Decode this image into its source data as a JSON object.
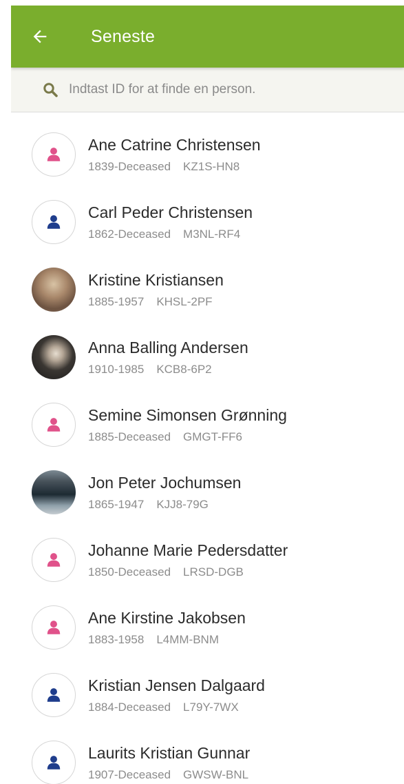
{
  "header": {
    "title": "Seneste",
    "back_icon": "arrow-left-icon",
    "color": "#7aae2d"
  },
  "search": {
    "placeholder": "Indtast ID for at finde en person.",
    "icon": "search-icon"
  },
  "colors": {
    "female": "#e0528a",
    "male": "#1f3d8c"
  },
  "people": [
    {
      "name": "Ane Catrine Christensen",
      "years": "1839-Deceased",
      "id": "KZ1S-HN8",
      "avatar": "female-icon"
    },
    {
      "name": "Carl Peder Christensen",
      "years": "1862-Deceased",
      "id": "M3NL-RF4",
      "avatar": "male-icon"
    },
    {
      "name": "Kristine Kristiansen",
      "years": "1885-1957",
      "id": "KHSL-2PF",
      "avatar": "photo"
    },
    {
      "name": "Anna Balling Andersen",
      "years": "1910-1985",
      "id": "KCB8-6P2",
      "avatar": "photo"
    },
    {
      "name": "Semine Simonsen Grønning",
      "years": "1885-Deceased",
      "id": "GMGT-FF6",
      "avatar": "female-icon"
    },
    {
      "name": "Jon Peter Jochumsen",
      "years": "1865-1947",
      "id": "KJJ8-79G",
      "avatar": "photo"
    },
    {
      "name": "Johanne Marie Pedersdatter",
      "years": "1850-Deceased",
      "id": "LRSD-DGB",
      "avatar": "female-icon"
    },
    {
      "name": "Ane Kirstine Jakobsen",
      "years": "1883-1958",
      "id": "L4MM-BNM",
      "avatar": "female-icon"
    },
    {
      "name": "Kristian Jensen Dalgaard",
      "years": "1884-Deceased",
      "id": "L79Y-7WX",
      "avatar": "male-icon"
    },
    {
      "name": "Laurits Kristian Gunnar",
      "years": "1907-Deceased",
      "id": "GWSW-BNL",
      "avatar": "male-icon"
    }
  ]
}
